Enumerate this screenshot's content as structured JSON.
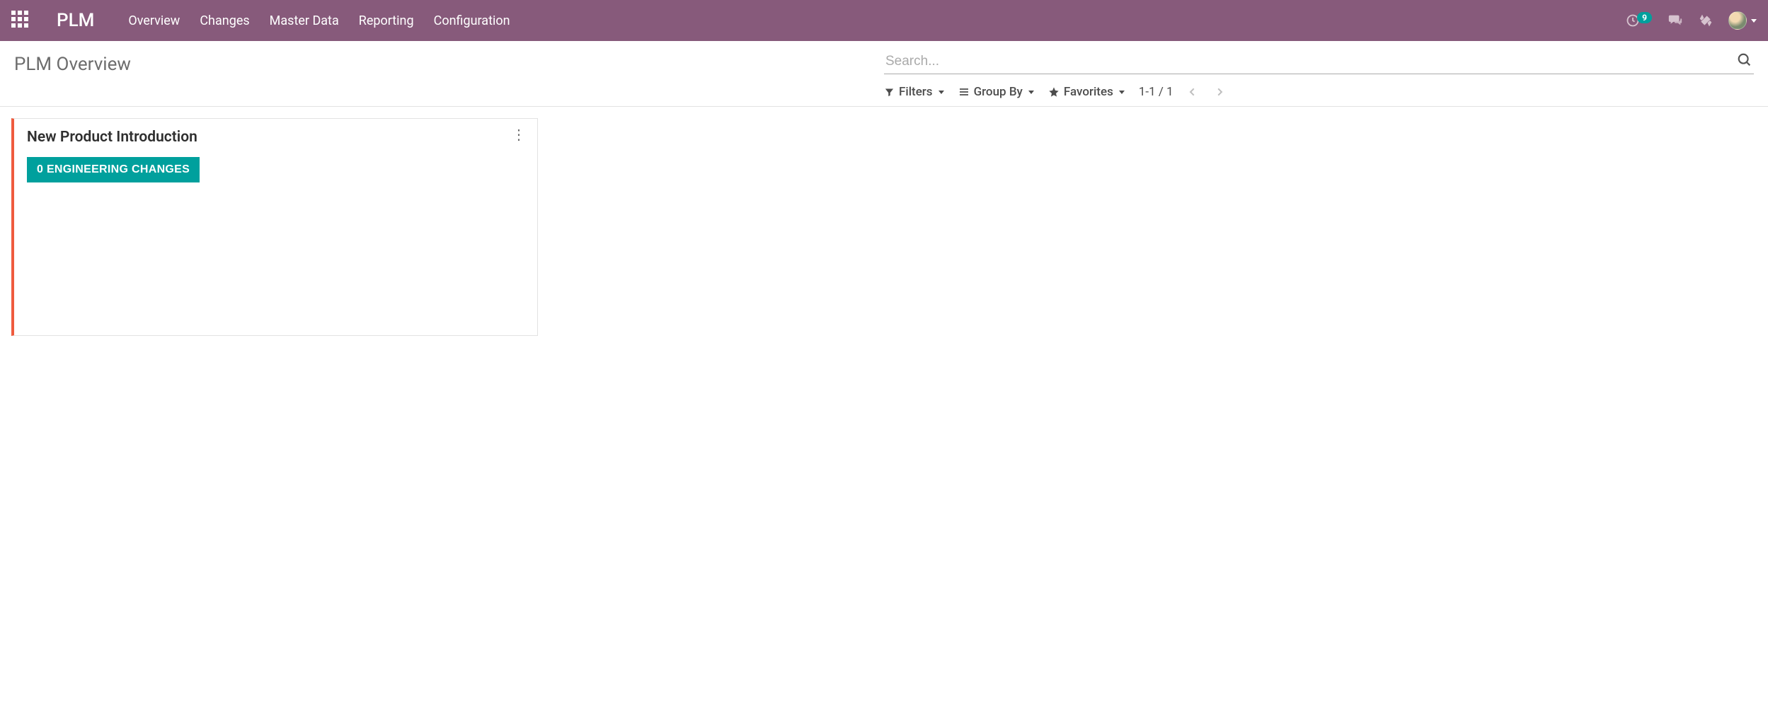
{
  "navbar": {
    "brand": "PLM",
    "menu": [
      {
        "label": "Overview"
      },
      {
        "label": "Changes"
      },
      {
        "label": "Master Data"
      },
      {
        "label": "Reporting"
      },
      {
        "label": "Configuration"
      }
    ],
    "activity_count": "9"
  },
  "control_panel": {
    "breadcrumb": "PLM Overview",
    "search_placeholder": "Search...",
    "filters_label": "Filters",
    "group_by_label": "Group By",
    "favorites_label": "Favorites",
    "pager": "1-1 / 1"
  },
  "kanban": {
    "cards": [
      {
        "title": "New Product Introduction",
        "button_label": "0 Engineering Changes"
      }
    ]
  }
}
